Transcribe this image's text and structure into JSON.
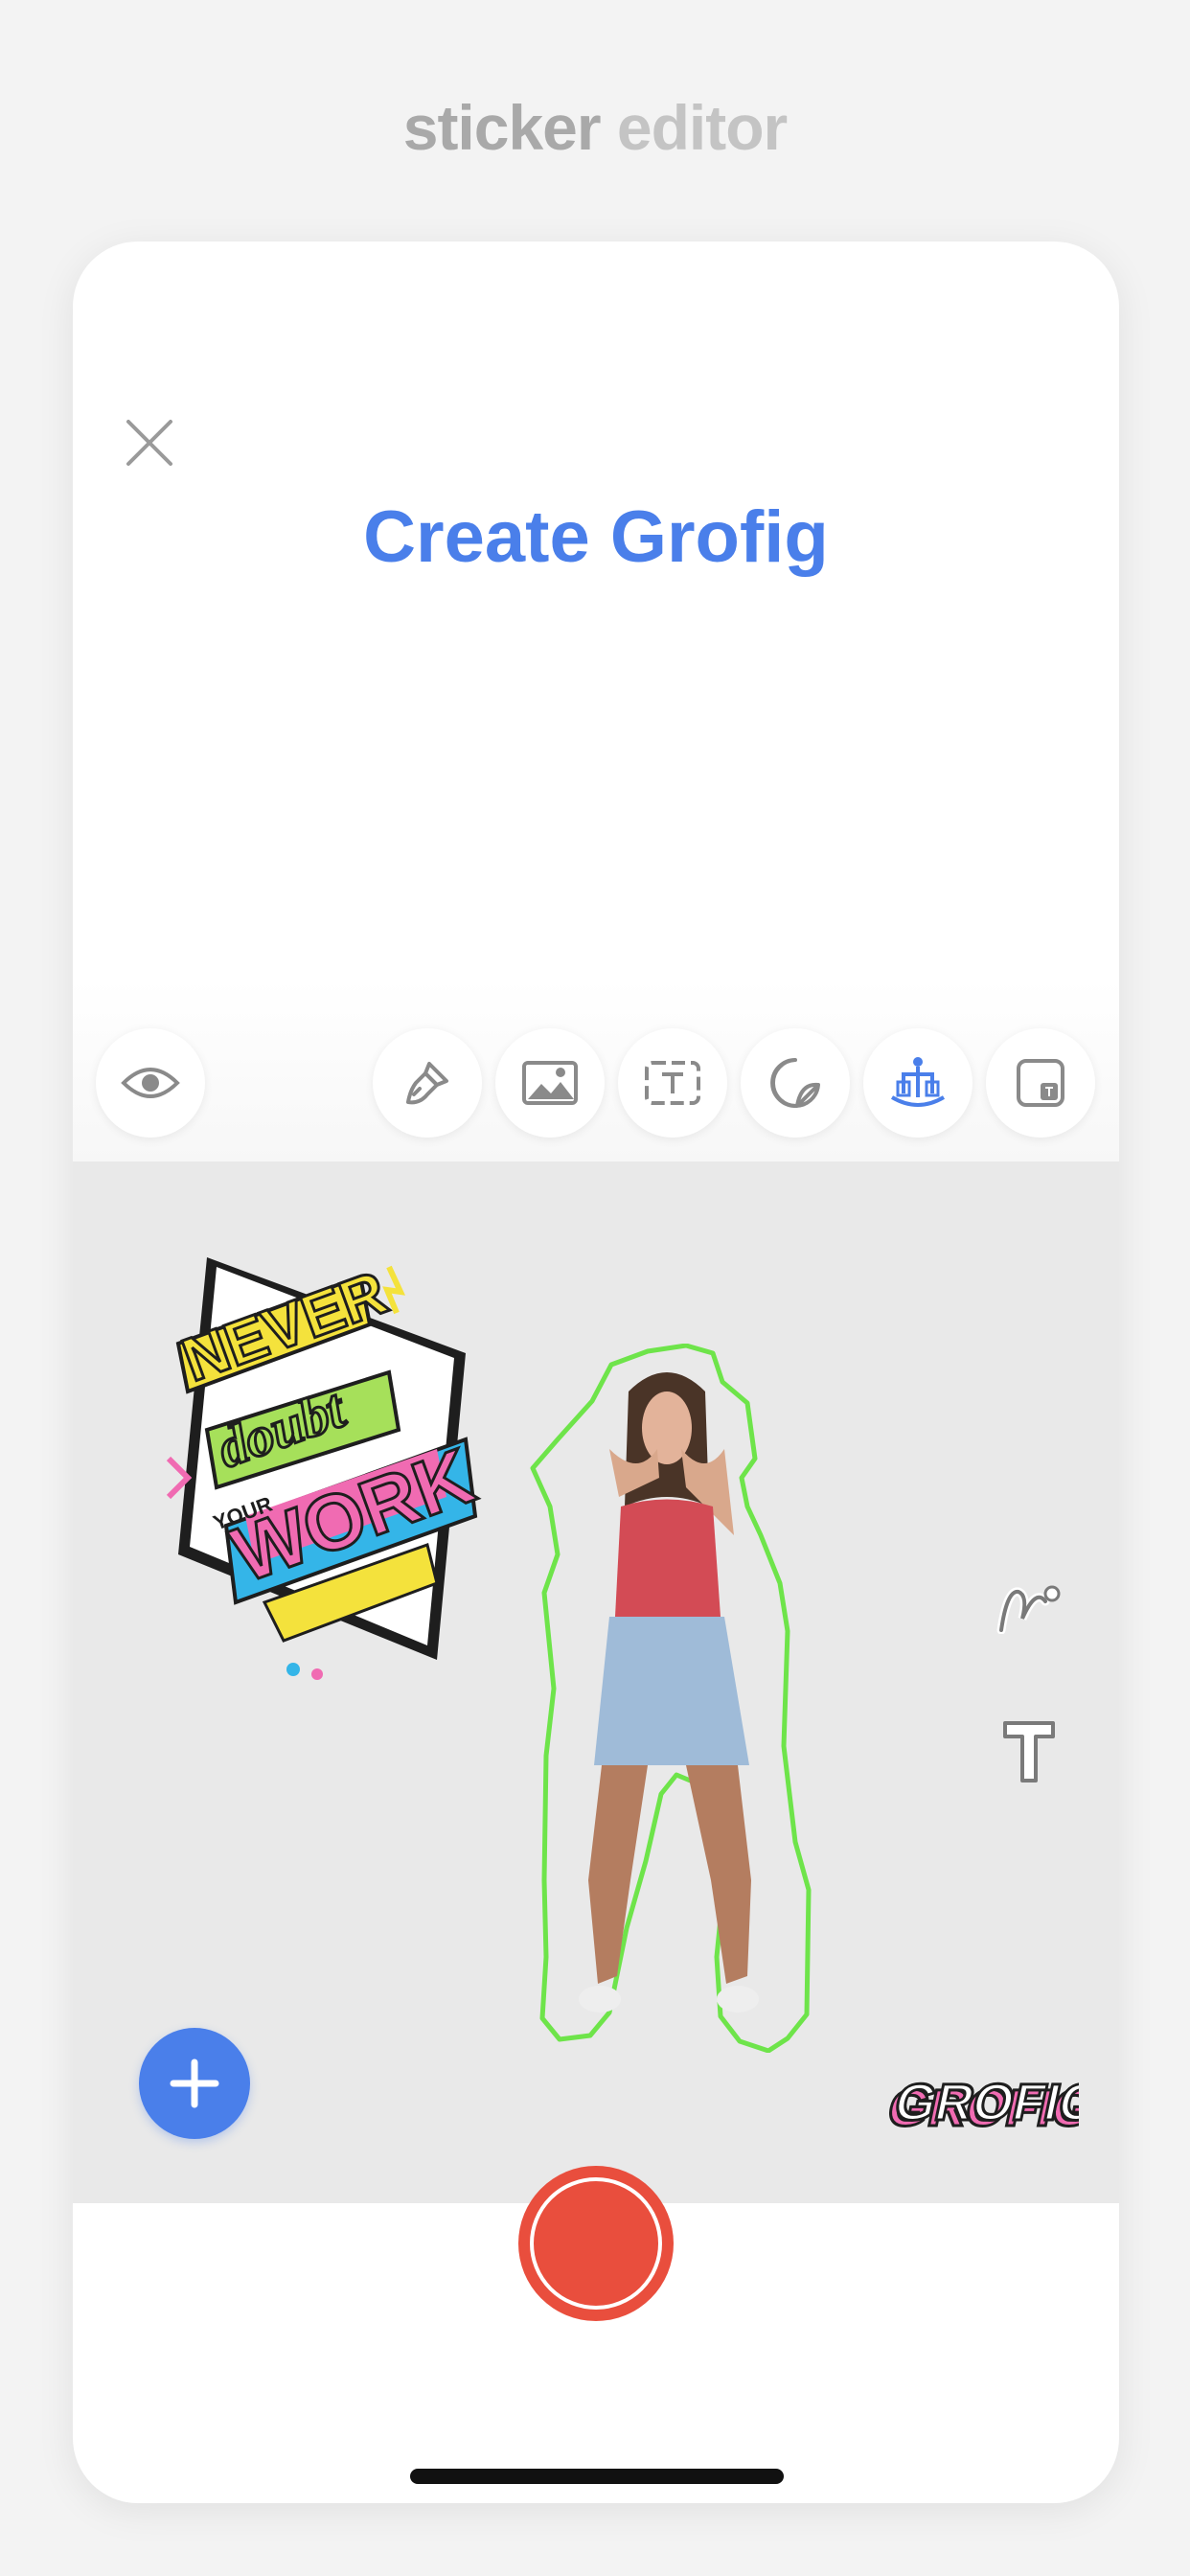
{
  "header": {
    "title_part1": "sticker",
    "title_part2": " editor"
  },
  "screen": {
    "title": "Create Grofig",
    "close_icon": "close-icon"
  },
  "toolbar": {
    "tools": [
      {
        "name": "visibility",
        "icon": "eye-icon"
      },
      {
        "name": "brush",
        "icon": "brush-icon"
      },
      {
        "name": "image",
        "icon": "image-icon"
      },
      {
        "name": "text",
        "icon": "text-box-icon"
      },
      {
        "name": "sticker",
        "icon": "sticker-icon"
      },
      {
        "name": "figure",
        "icon": "figure-icon",
        "active": true
      },
      {
        "name": "watermark",
        "icon": "watermark-icon"
      }
    ],
    "active_color": "#4a7fea"
  },
  "canvas": {
    "quote_sticker": {
      "lines": [
        "NEVER",
        "doubt",
        "YOUR",
        "WORK"
      ]
    },
    "side_tools": [
      {
        "name": "path",
        "icon": "path-tool-icon"
      },
      {
        "name": "text",
        "icon": "text-tool-icon"
      }
    ],
    "watermark_text": "GROFIG",
    "add_label": "+"
  },
  "colors": {
    "accent": "#4a7fea",
    "record": "#e94e3d",
    "outline": "#6ee44a"
  }
}
